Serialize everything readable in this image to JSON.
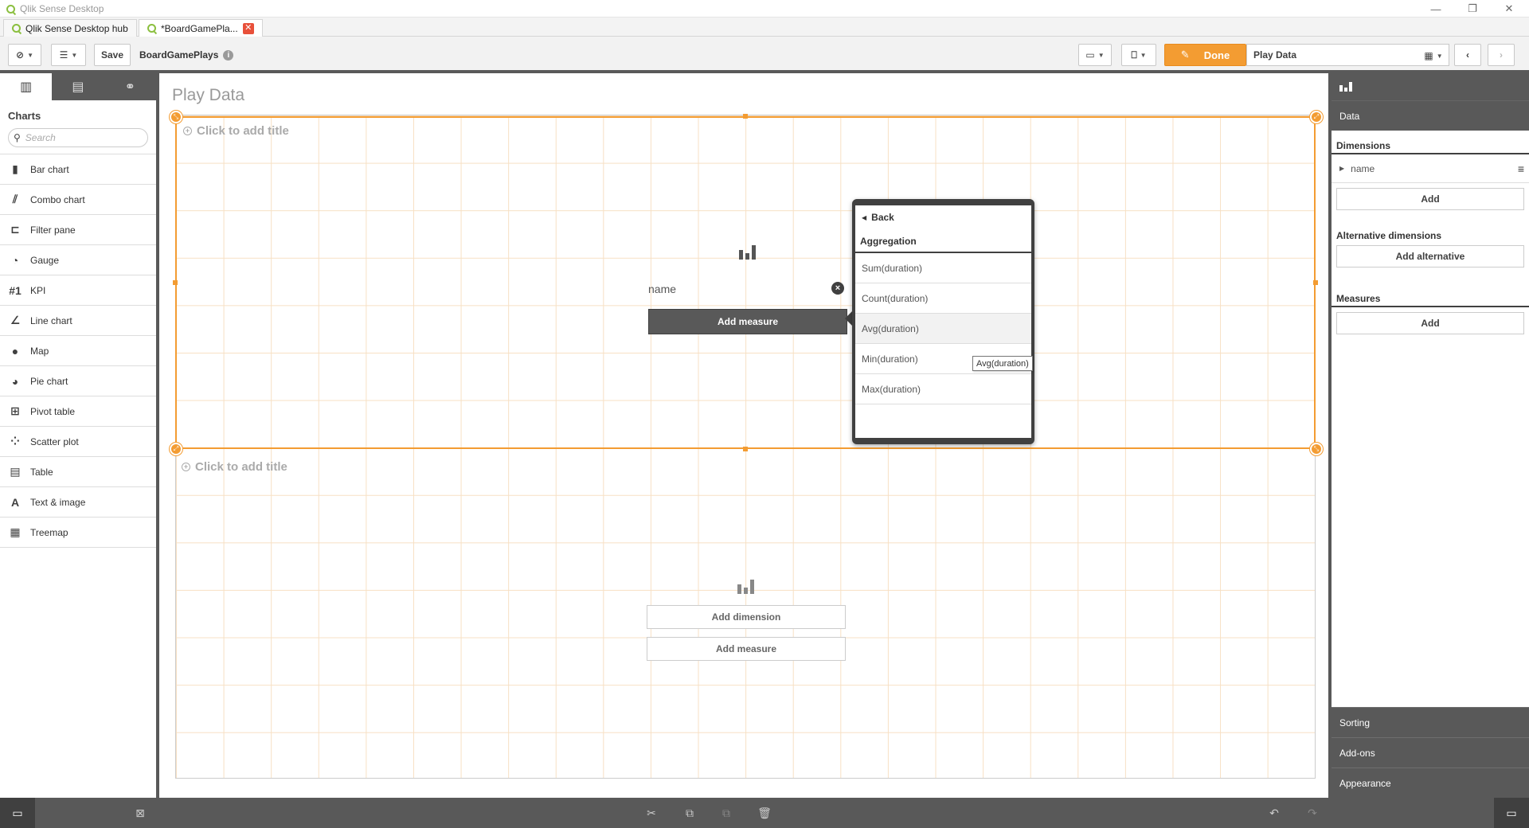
{
  "window": {
    "title": "Qlik Sense Desktop"
  },
  "tabs": [
    {
      "label": "Qlik Sense Desktop hub"
    },
    {
      "label": "*BoardGamePla..."
    }
  ],
  "toolbar": {
    "save_label": "Save",
    "app_name": "BoardGamePlays",
    "done_label": "Done",
    "sheet_name": "Play Data"
  },
  "assets": {
    "heading": "Charts",
    "search_placeholder": "Search",
    "charts": [
      {
        "label": "Bar chart",
        "icon": "bar-chart-icon"
      },
      {
        "label": "Combo chart",
        "icon": "combo-chart-icon"
      },
      {
        "label": "Filter pane",
        "icon": "filter-pane-icon"
      },
      {
        "label": "Gauge",
        "icon": "gauge-icon"
      },
      {
        "label": "KPI",
        "icon": "kpi-icon"
      },
      {
        "label": "Line chart",
        "icon": "line-chart-icon"
      },
      {
        "label": "Map",
        "icon": "map-icon"
      },
      {
        "label": "Pie chart",
        "icon": "pie-chart-icon"
      },
      {
        "label": "Pivot table",
        "icon": "pivot-table-icon"
      },
      {
        "label": "Scatter plot",
        "icon": "scatter-plot-icon"
      },
      {
        "label": "Table",
        "icon": "table-icon"
      },
      {
        "label": "Text & image",
        "icon": "text-image-icon"
      },
      {
        "label": "Treemap",
        "icon": "treemap-icon"
      }
    ]
  },
  "sheet": {
    "title": "Play Data",
    "object1": {
      "title_placeholder": "Click to add title",
      "dimension": "name",
      "add_measure": "Add measure"
    },
    "object2": {
      "title_placeholder": "Click to add title",
      "add_dimension": "Add dimension",
      "add_measure": "Add measure"
    }
  },
  "popover": {
    "back": "Back",
    "heading": "Aggregation",
    "items": [
      "Sum(duration)",
      "Count(duration)",
      "Avg(duration)",
      "Min(duration)",
      "Max(duration)"
    ],
    "tooltip": "Avg(duration)"
  },
  "properties": {
    "section": "Data",
    "dimensions_label": "Dimensions",
    "dimension_item": "name",
    "add_label": "Add",
    "alt_dimensions_label": "Alternative dimensions",
    "add_alternative_label": "Add alternative",
    "measures_label": "Measures",
    "add_measure_label": "Add",
    "accordion": [
      "Sorting",
      "Add-ons",
      "Appearance"
    ]
  },
  "colors": {
    "accent": "#f39c32",
    "chrome": "#595959"
  }
}
